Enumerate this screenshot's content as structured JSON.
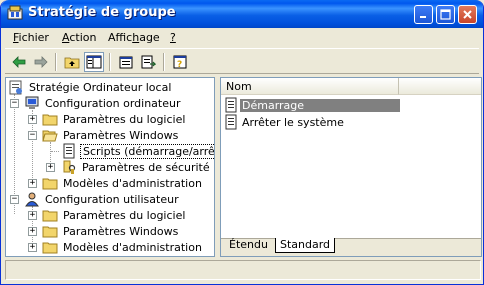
{
  "window": {
    "title": "Stratégie de groupe",
    "icon": "group-policy-icon",
    "controls": [
      "minimize-icon",
      "maximize-icon",
      "close-icon"
    ]
  },
  "menubar": {
    "items": [
      {
        "label": "Fichier",
        "accel": "F"
      },
      {
        "label": "Action",
        "accel": "A"
      },
      {
        "label": "Affichage",
        "accel": "h"
      },
      {
        "label": "?",
        "accel": "?"
      }
    ]
  },
  "toolbar": {
    "buttons": [
      "back-icon",
      "forward-icon",
      "up-folder-icon",
      "show-hide-tree-icon",
      "properties-icon",
      "export-list-icon",
      "help-icon"
    ]
  },
  "tree": {
    "root": {
      "label": "Stratégie Ordinateur local"
    },
    "computer": {
      "label": "Configuration ordinateur",
      "software": "Paramètres du logiciel",
      "windows": "Paramètres Windows",
      "scripts": "Scripts (démarrage/arrêt)",
      "security": "Paramètres de sécurité",
      "admin": "Modèles d'administration"
    },
    "user": {
      "label": "Configuration utilisateur",
      "software": "Paramètres du logiciel",
      "windows": "Paramètres Windows",
      "admin": "Modèles d'administration"
    }
  },
  "list": {
    "column": "Nom",
    "items": [
      {
        "label": "Démarrage",
        "selected": true
      },
      {
        "label": "Arrêter le système",
        "selected": false
      }
    ]
  },
  "tabs": {
    "extended": "Étendu",
    "standard": "Standard",
    "active": "Standard"
  },
  "colors": {
    "titlebar": "#0058ee",
    "selection": "#808080",
    "pane_border": "#7f9db9"
  }
}
